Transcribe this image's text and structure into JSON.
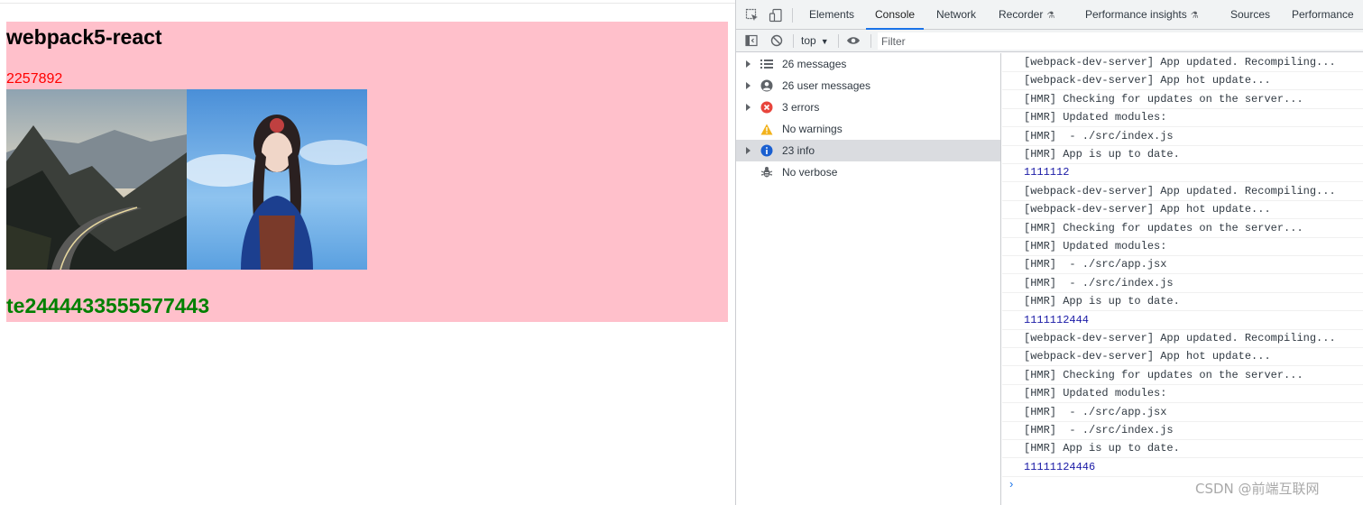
{
  "page": {
    "title": "webpack5-react",
    "counter": "2257892",
    "footer_text": "te2444433555577443",
    "images": [
      {
        "alt": "mountain-road"
      },
      {
        "alt": "girl-portrait"
      }
    ]
  },
  "devtools": {
    "tabs": [
      {
        "label": "Elements",
        "active": false
      },
      {
        "label": "Console",
        "active": true
      },
      {
        "label": "Network",
        "active": false
      },
      {
        "label": "Recorder",
        "active": false,
        "experimental": true
      },
      {
        "label": "Performance insights",
        "active": false,
        "experimental": true
      },
      {
        "label": "Sources",
        "active": false
      },
      {
        "label": "Performance",
        "active": false
      }
    ],
    "toolbar": {
      "context": "top",
      "filter_placeholder": "Filter"
    },
    "sidebar": [
      {
        "label": "26 messages",
        "icon": "list-icon",
        "expandable": true,
        "selected": false
      },
      {
        "label": "26 user messages",
        "icon": "user-icon",
        "expandable": true,
        "selected": false
      },
      {
        "label": "3 errors",
        "icon": "error-icon",
        "expandable": true,
        "selected": false
      },
      {
        "label": "No warnings",
        "icon": "warning-icon",
        "expandable": false,
        "selected": false
      },
      {
        "label": "23 info",
        "icon": "info-icon",
        "expandable": true,
        "selected": true
      },
      {
        "label": "No verbose",
        "icon": "bug-icon",
        "expandable": false,
        "selected": false
      }
    ],
    "console_lines": [
      {
        "text": "[webpack-dev-server] App updated. Recompiling...",
        "kind": "log"
      },
      {
        "text": "[webpack-dev-server] App hot update...",
        "kind": "log"
      },
      {
        "text": "[HMR] Checking for updates on the server...",
        "kind": "log"
      },
      {
        "text": "[HMR] Updated modules:",
        "kind": "log"
      },
      {
        "text": "[HMR]  - ./src/index.js",
        "kind": "log"
      },
      {
        "text": "[HMR] App is up to date.",
        "kind": "log"
      },
      {
        "text": "1111112",
        "kind": "num"
      },
      {
        "text": "[webpack-dev-server] App updated. Recompiling...",
        "kind": "log"
      },
      {
        "text": "[webpack-dev-server] App hot update...",
        "kind": "log"
      },
      {
        "text": "[HMR] Checking for updates on the server...",
        "kind": "log"
      },
      {
        "text": "[HMR] Updated modules:",
        "kind": "log"
      },
      {
        "text": "[HMR]  - ./src/app.jsx",
        "kind": "log"
      },
      {
        "text": "[HMR]  - ./src/index.js",
        "kind": "log"
      },
      {
        "text": "[HMR] App is up to date.",
        "kind": "log"
      },
      {
        "text": "1111112444",
        "kind": "num"
      },
      {
        "text": "[webpack-dev-server] App updated. Recompiling...",
        "kind": "log"
      },
      {
        "text": "[webpack-dev-server] App hot update...",
        "kind": "log"
      },
      {
        "text": "[HMR] Checking for updates on the server...",
        "kind": "log"
      },
      {
        "text": "[HMR] Updated modules:",
        "kind": "log"
      },
      {
        "text": "[HMR]  - ./src/app.jsx",
        "kind": "log"
      },
      {
        "text": "[HMR]  - ./src/index.js",
        "kind": "log"
      },
      {
        "text": "[HMR] App is up to date.",
        "kind": "log"
      },
      {
        "text": "11111124446",
        "kind": "num"
      }
    ]
  },
  "watermark": "CSDN @前端互联网"
}
